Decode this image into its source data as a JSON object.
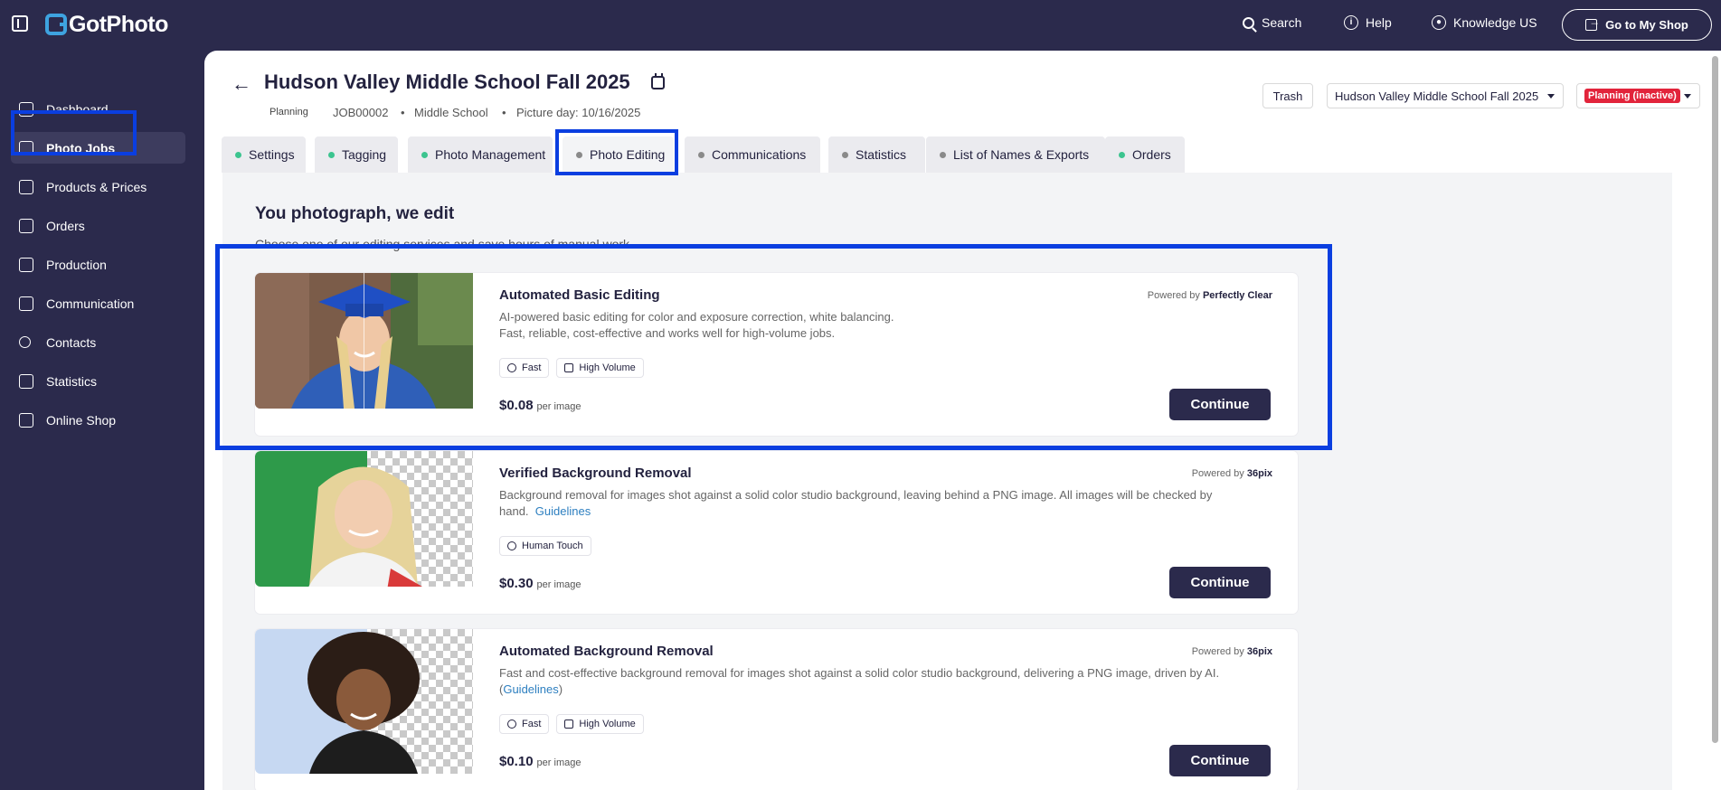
{
  "app": {
    "name": "GotPhoto"
  },
  "topbar": {
    "search": "Search",
    "help": "Help",
    "knowledge": "Knowledge US",
    "shop_button": "Go to My Shop"
  },
  "sidebar": {
    "items": [
      {
        "label": "Dashboard",
        "icon": "home-icon"
      },
      {
        "label": "Photo Jobs",
        "icon": "image-icon",
        "active": true
      },
      {
        "label": "Products & Prices",
        "icon": "cart-icon"
      },
      {
        "label": "Orders",
        "icon": "box-icon"
      },
      {
        "label": "Production",
        "icon": "printer-icon"
      },
      {
        "label": "Communication",
        "icon": "message-icon"
      },
      {
        "label": "Contacts",
        "icon": "person-icon"
      },
      {
        "label": "Statistics",
        "icon": "chart-icon"
      },
      {
        "label": "Online Shop",
        "icon": "store-icon"
      }
    ]
  },
  "job": {
    "title": "Hudson Valley Middle School Fall 2025",
    "status_label": "Planning",
    "job_id": "JOB00002",
    "school_type": "Middle School",
    "picture_day": "Picture day: 10/16/2025",
    "trash": "Trash",
    "job_select": "Hudson Valley Middle School Fall 2025",
    "status_badge": "Planning (inactive)"
  },
  "tabs": [
    {
      "label": "Settings",
      "dot": "#3cc48f"
    },
    {
      "label": "Tagging",
      "dot": "#3cc48f"
    },
    {
      "label": "Photo Management",
      "dot": "#3cc48f"
    },
    {
      "label": "Photo Editing",
      "dot": "#8a8a8a",
      "active": true
    },
    {
      "label": "Communications",
      "dot": "#8a8a8a"
    },
    {
      "label": "Statistics",
      "dot": "#8a8a8a"
    },
    {
      "label": "List of Names & Exports",
      "dot": "#8a8a8a"
    },
    {
      "label": "Orders",
      "dot": "#3cc48f"
    }
  ],
  "section": {
    "title": "You photograph, we edit",
    "subtitle": "Choose one of our editing services and save hours of manual work."
  },
  "services": [
    {
      "title": "Automated Basic Editing",
      "powered_prefix": "Powered by",
      "powered_by": "Perfectly Clear",
      "desc1": "AI-powered basic editing for color and exposure correction, white balancing.",
      "desc2": "Fast, reliable, cost-effective and works well for high-volume jobs.",
      "chips": [
        "Fast",
        "High Volume"
      ],
      "price": "$0.08",
      "unit": "per image",
      "button": "Continue"
    },
    {
      "title": "Verified Background Removal",
      "powered_prefix": "Powered by",
      "powered_by": "36pix",
      "desc1": "Background removal for images shot against a solid color studio background, leaving behind a PNG image. All images will be checked by",
      "desc2": "hand.",
      "link": "Guidelines",
      "chips": [
        "Human Touch"
      ],
      "price": "$0.30",
      "unit": "per image",
      "button": "Continue"
    },
    {
      "title": "Automated Background Removal",
      "powered_prefix": "Powered by",
      "powered_by": "36pix",
      "desc1": "Fast and cost-effective background removal for images shot against a solid color studio background, delivering a PNG image, driven by AI.",
      "desc2_open": "(",
      "link": "Guidelines",
      "desc2_close": ")",
      "chips": [
        "Fast",
        "High Volume"
      ],
      "price": "$0.10",
      "unit": "per image",
      "button": "Continue"
    }
  ],
  "colors": {
    "sidebar": "#2b2a4c",
    "highlight": "#0a3ee0",
    "badge_red": "#e2243b",
    "green_dot": "#3cc48f"
  }
}
